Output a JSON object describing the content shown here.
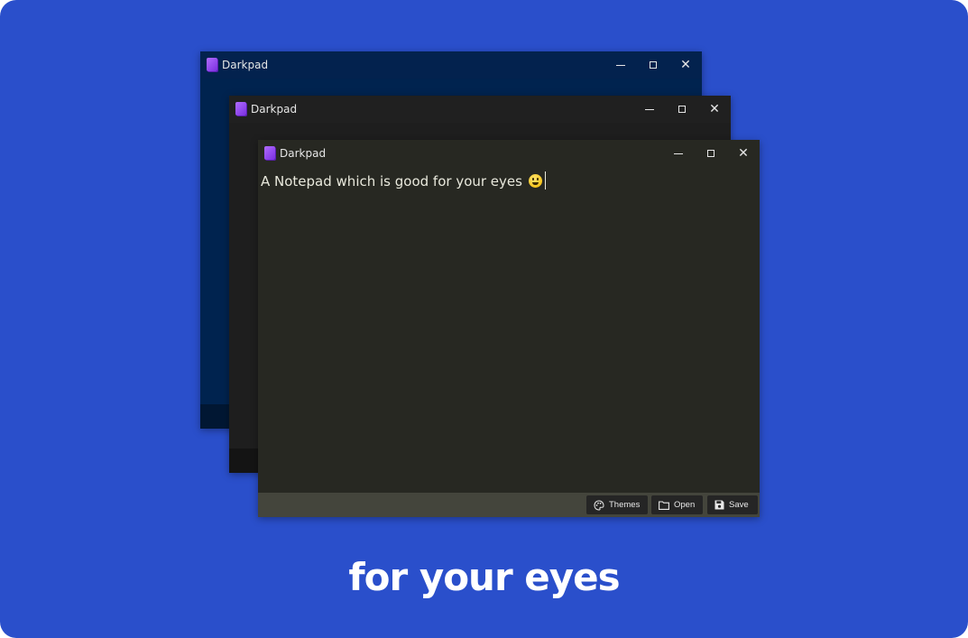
{
  "colors": {
    "background": "#2a4fcb",
    "navy_window": "#00234f",
    "gray_window": "#1e1e1e",
    "monokai_window": "#272822",
    "logo": "#8f44ee"
  },
  "windows": [
    {
      "title": "Darkpad",
      "theme": "navy",
      "controls": {
        "minimize_icon": "minimize-icon",
        "maximize_icon": "maximize-icon",
        "close_icon": "close-icon"
      }
    },
    {
      "title": "Darkpad",
      "theme": "dark-gray",
      "controls": {
        "minimize_icon": "minimize-icon",
        "maximize_icon": "maximize-icon",
        "close_icon": "close-icon"
      }
    },
    {
      "title": "Darkpad",
      "theme": "monokai",
      "editor_text": "A Notepad which is good for your eyes",
      "controls": {
        "minimize_icon": "minimize-icon",
        "maximize_icon": "maximize-icon",
        "close_icon": "close-icon"
      },
      "toolbar": {
        "themes_label": "Themes",
        "open_label": "Open",
        "save_label": "Save"
      }
    }
  ],
  "tagline": "for your eyes"
}
